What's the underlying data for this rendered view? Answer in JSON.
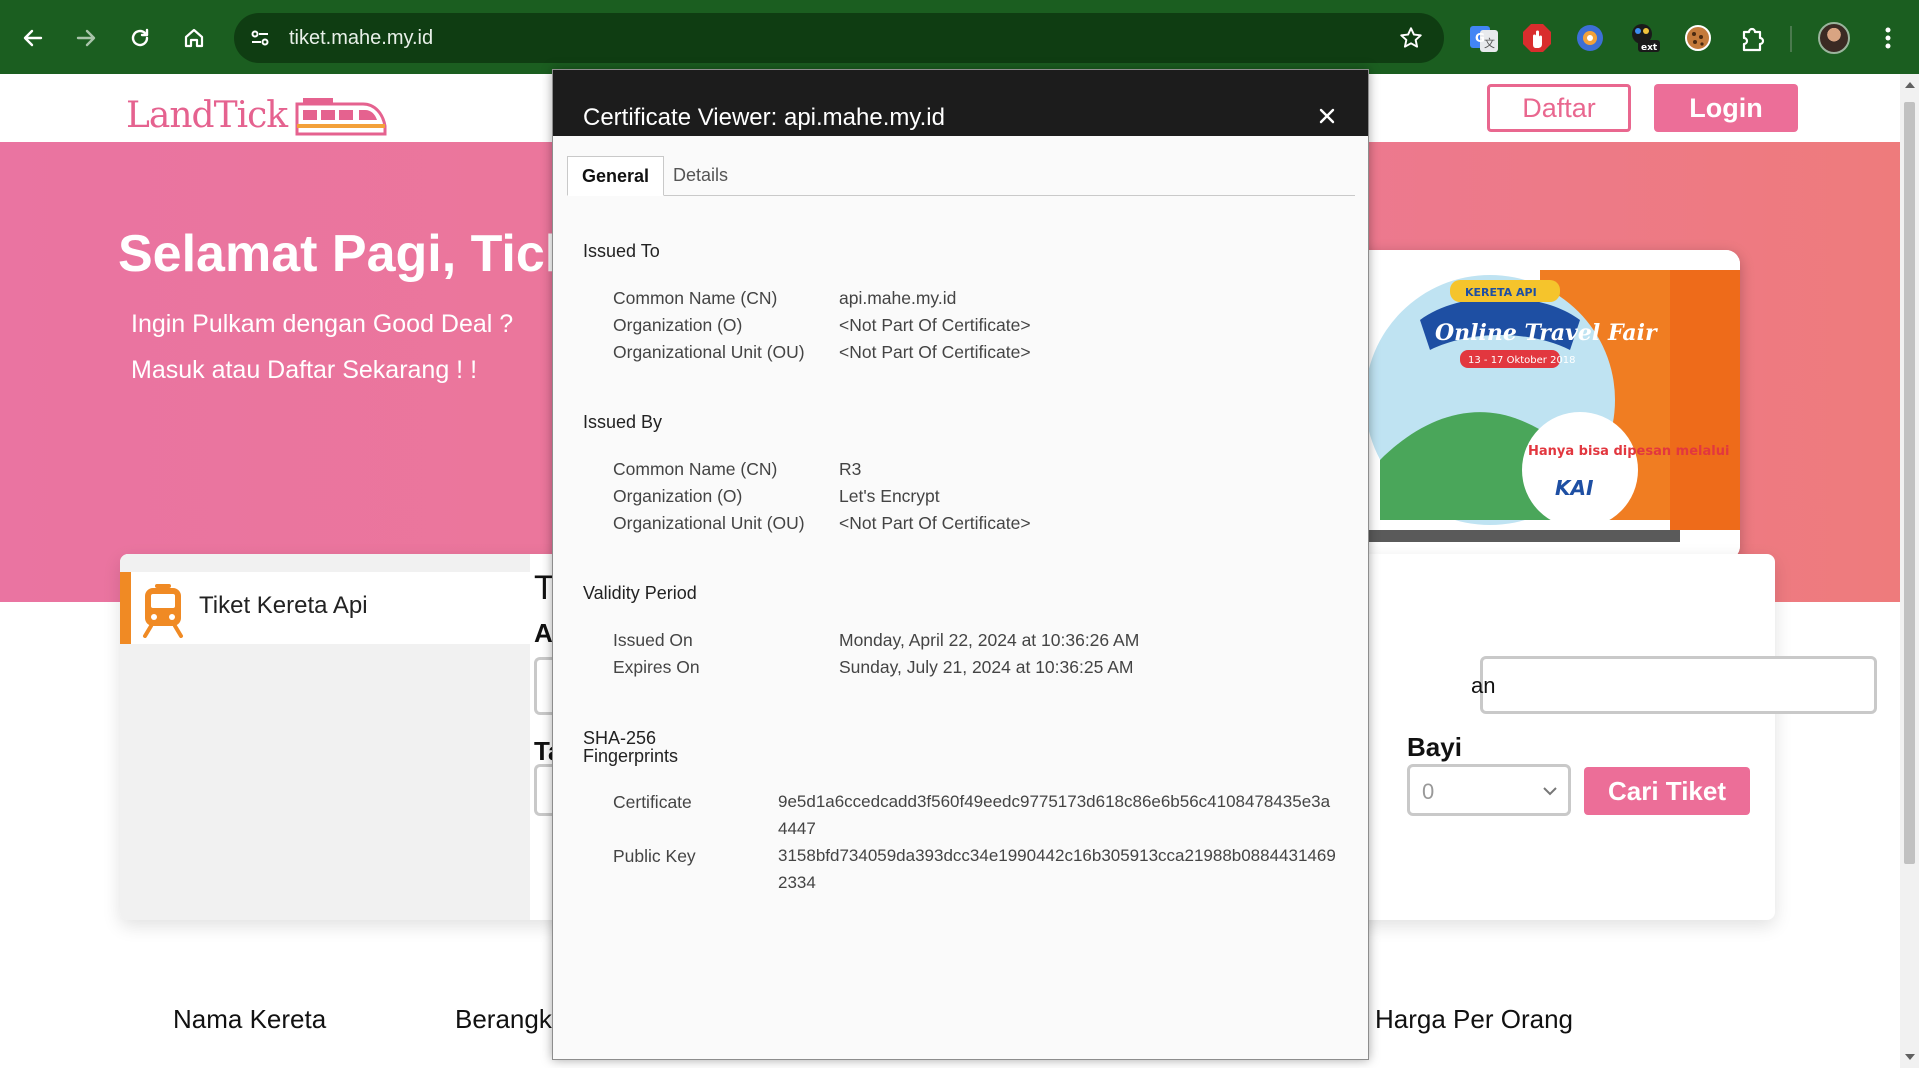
{
  "browser": {
    "url": "tiket.mahe.my.id",
    "ext_badge": "ext"
  },
  "site": {
    "logo_text": "LandTick",
    "daftar_label": "Daftar",
    "login_label": "Login",
    "hero_title": "Selamat Pagi, Tick",
    "hero_line1": "Ingin Pulkam dengan Good Deal ?",
    "hero_line2": "Masuk atau Daftar Sekarang ! !",
    "promo": {
      "brand": "KERETA API",
      "title": "Online Travel Fair",
      "dates": "13 - 17 Oktober 2018",
      "note": "Hanya bisa dipesan melalui",
      "kai": "KAI"
    },
    "tab_label": "Tiket Kereta Api",
    "partial": {
      "t_heading": "T",
      "a_label": "A",
      "ta_label": "Ta",
      "field_suffix": "an"
    },
    "bayi_label": "Bayi",
    "bayi_value": "0",
    "cari_label": "Cari Tiket",
    "columns": [
      "Nama Kereta",
      "Berangk",
      "Harga Per Orang"
    ]
  },
  "certificate": {
    "title": "Certificate Viewer: api.mahe.my.id",
    "tabs": [
      "General",
      "Details"
    ],
    "issued_to": {
      "heading": "Issued To",
      "rows": [
        {
          "label": "Common Name (CN)",
          "value": "api.mahe.my.id"
        },
        {
          "label": "Organization (O)",
          "value": "<Not Part Of Certificate>"
        },
        {
          "label": "Organizational Unit (OU)",
          "value": "<Not Part Of Certificate>"
        }
      ]
    },
    "issued_by": {
      "heading": "Issued By",
      "rows": [
        {
          "label": "Common Name (CN)",
          "value": "R3"
        },
        {
          "label": "Organization (O)",
          "value": "Let's Encrypt"
        },
        {
          "label": "Organizational Unit (OU)",
          "value": "<Not Part Of Certificate>"
        }
      ]
    },
    "validity": {
      "heading": "Validity Period",
      "rows": [
        {
          "label": "Issued On",
          "value": "Monday, April 22, 2024 at 10:36:26 AM"
        },
        {
          "label": "Expires On",
          "value": "Sunday, July 21, 2024 at 10:36:25 AM"
        }
      ]
    },
    "fingerprints": {
      "heading_line1": "SHA-256",
      "heading_line2": "Fingerprints",
      "rows": [
        {
          "label": "Certificate",
          "value": "9e5d1a6ccedcadd3f560f49eedc9775173d618c86e6b56c4108478435e3a4447"
        },
        {
          "label": "Public Key",
          "value": "3158bfd734059da393dcc34e1990442c16b305913cca21988b08844314692334"
        }
      ]
    }
  },
  "colors": {
    "chrome": "#1b5e20",
    "brand_pink": "#ec6e98",
    "accent_orange": "#f08a24"
  }
}
